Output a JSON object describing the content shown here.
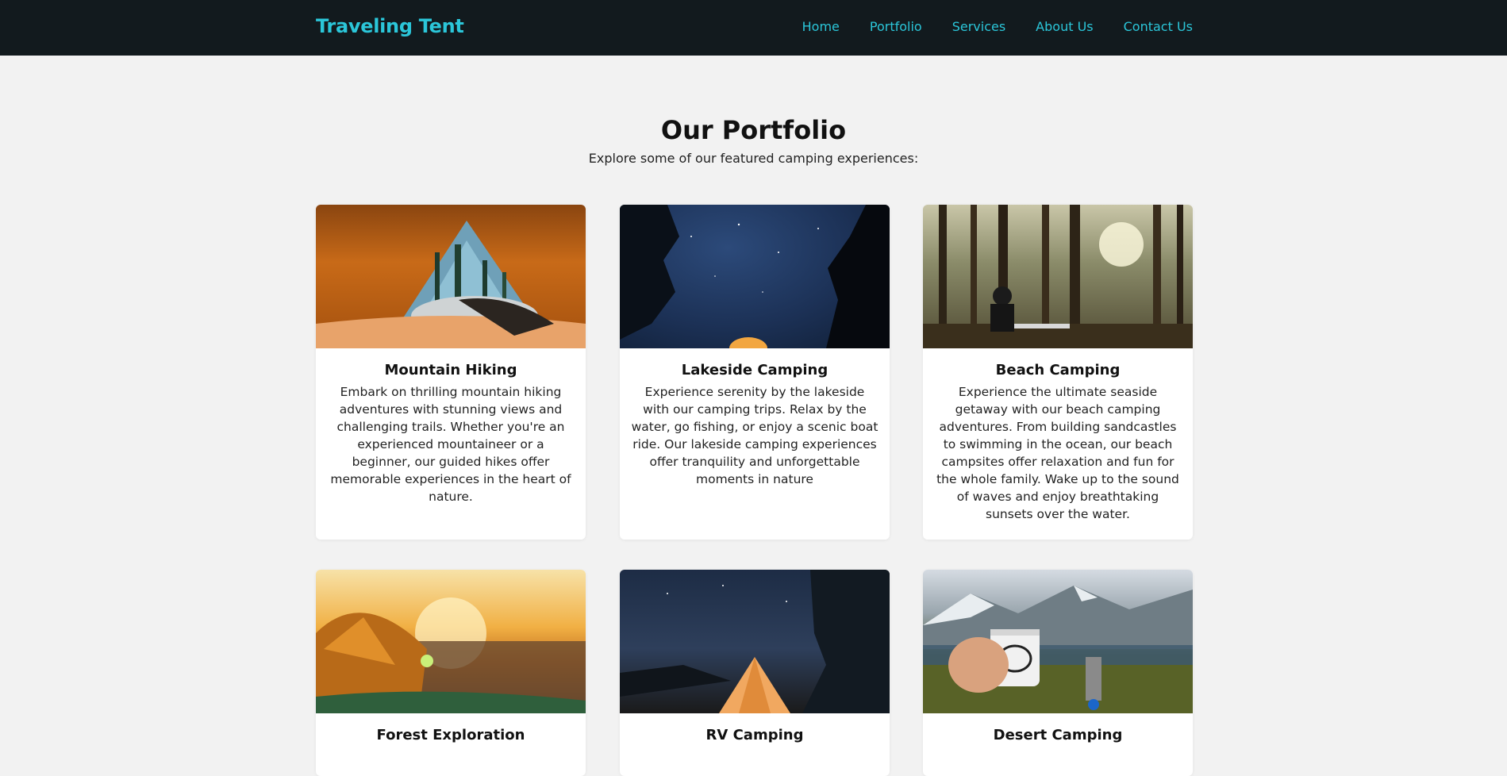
{
  "nav": {
    "brand": "Traveling Tent",
    "links": [
      "Home",
      "Portfolio",
      "Services",
      "About Us",
      "Contact Us"
    ]
  },
  "header": {
    "title": "Our Portfolio",
    "subtitle": "Explore some of our featured camping experiences:"
  },
  "cards": [
    {
      "title": "Mountain Hiking",
      "desc": "Embark on thrilling mountain hiking adventures with stunning views and challenging trails. Whether you're an experienced mountaineer or a beginner, our guided hikes offer memorable experiences in the heart of nature."
    },
    {
      "title": "Lakeside Camping",
      "desc": "Experience serenity by the lakeside with our camping trips. Relax by the water, go fishing, or enjoy a scenic boat ride. Our lakeside camping experiences offer tranquility and unforgettable moments in nature"
    },
    {
      "title": "Beach Camping",
      "desc": "Experience the ultimate seaside getaway with our beach camping adventures. From building sandcastles to swimming in the ocean, our beach campsites offer relaxation and fun for the whole family. Wake up to the sound of waves and enjoy breathtaking sunsets over the water."
    },
    {
      "title": "Forest Exploration",
      "desc": ""
    },
    {
      "title": "RV Camping",
      "desc": ""
    },
    {
      "title": "Desert Camping",
      "desc": ""
    }
  ],
  "colors": {
    "navbar_bg": "#121a1e",
    "accent": "#2bc6d9",
    "page_bg": "#f2f2f2"
  }
}
